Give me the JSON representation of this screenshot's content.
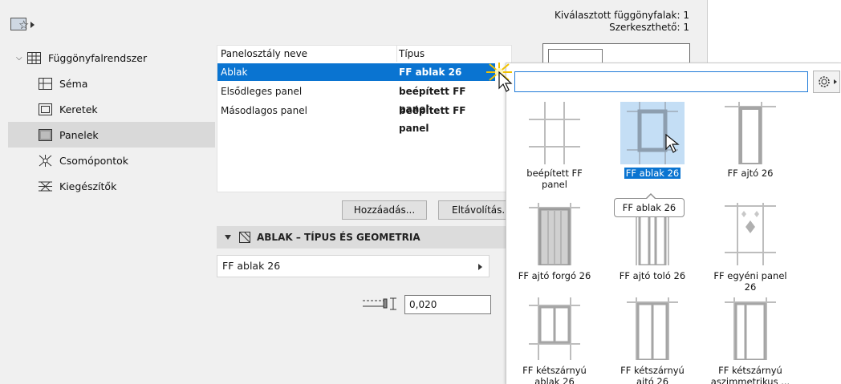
{
  "header": {
    "selected_curtain_walls": "Kiválasztott függönyfalak: 1",
    "editable": "Szerkeszthető: 1"
  },
  "sidebar": {
    "items": [
      {
        "label": "Függönyfalrendszer",
        "icon": "curtain-wall-system-icon",
        "expanded": true
      },
      {
        "label": "Séma",
        "icon": "scheme-icon"
      },
      {
        "label": "Keretek",
        "icon": "frames-icon"
      },
      {
        "label": "Panelek",
        "icon": "panels-icon",
        "selected": true
      },
      {
        "label": "Csomópontok",
        "icon": "junctions-icon"
      },
      {
        "label": "Kiegészítők",
        "icon": "accessories-icon"
      }
    ]
  },
  "panel_table": {
    "columns": [
      "Panelosztály neve",
      "Típus"
    ],
    "rows": [
      {
        "name": "Ablak",
        "type": "FF ablak 26",
        "selected": true
      },
      {
        "name": "Elsődleges panel",
        "type": "beépített FF panel"
      },
      {
        "name": "Másodlagos panel",
        "type": "beépített FF panel"
      }
    ]
  },
  "buttons": {
    "add": "Hozzáadás...",
    "remove": "Eltávolítás..."
  },
  "section": {
    "title": "ABLAK – TÍPUS ÉS GEOMETRIA",
    "type_value": "FF ablak 26",
    "offset_value": "0,020"
  },
  "popup": {
    "search_value": "",
    "tiles": [
      {
        "lines": [
          "beépített FF",
          "panel"
        ],
        "thumb": "builtin-panel"
      },
      {
        "lines": [
          "FF ablak 26"
        ],
        "thumb": "window",
        "selected": true
      },
      {
        "lines": [
          "FF ajtó 26"
        ],
        "thumb": "door"
      },
      {
        "lines": [
          "FF ajtó forgó 26"
        ],
        "thumb": "revolving-door"
      },
      {
        "lines": [
          "FF ajtó toló 26"
        ],
        "thumb": "sliding-door"
      },
      {
        "lines": [
          "FF egyéni panel",
          "26"
        ],
        "thumb": "custom-panel"
      },
      {
        "lines": [
          "FF kétszárnyú",
          "ablak 26"
        ],
        "thumb": "double-window"
      },
      {
        "lines": [
          "FF kétszárnyú",
          "ajtó 26"
        ],
        "thumb": "double-door"
      },
      {
        "lines": [
          "FF kétszárnyú",
          "aszimmetrikus ..."
        ],
        "thumb": "asymmetric-double"
      }
    ],
    "tooltip": "FF ablak 26"
  },
  "colors": {
    "selection": "#0a74d1",
    "tile_selection": "#c4def5",
    "dialog_bg": "#f0f0f0"
  }
}
